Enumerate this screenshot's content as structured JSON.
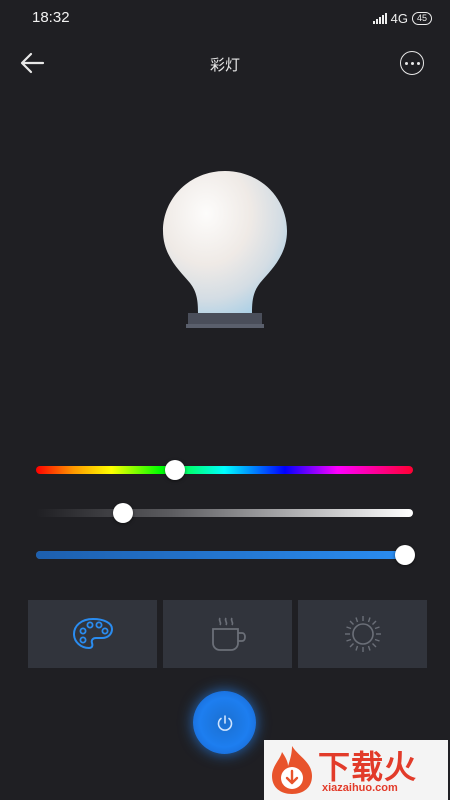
{
  "status_bar": {
    "time": "18:32",
    "network": "4G",
    "battery": "45"
  },
  "header": {
    "title": "彩灯"
  },
  "icons": {
    "back": "arrow-left-icon",
    "more": "more-horizontal-icon",
    "bulb": "light-bulb-icon",
    "palette": "palette-icon",
    "coffee": "coffee-cup-icon",
    "sun": "sun-icon",
    "power": "power-icon"
  },
  "sliders": {
    "hue": 0.37,
    "saturation": 0.23,
    "brightness": 0.98
  },
  "modes": [
    "color",
    "coffee",
    "sun"
  ],
  "colors": {
    "accent": "#1d7ef0",
    "background": "#1f1f23",
    "tile": "#31343c"
  },
  "watermark": {
    "name": "下载火",
    "url": "xiazaihuo.com"
  }
}
